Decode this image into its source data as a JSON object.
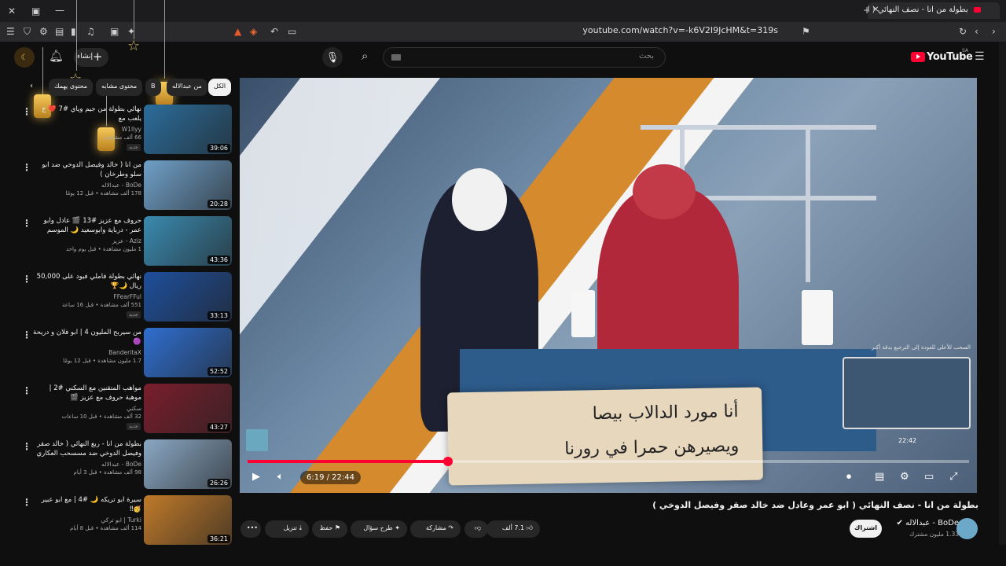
{
  "browser": {
    "tab_title": "بطولة من انا - نصف النهائي ( ا...",
    "url": "youtube.com/watch?v=-k6V2I9JcHM&t=319s",
    "new_tab": "+",
    "close_tab": "✕"
  },
  "masthead": {
    "logo": "YouTube",
    "logo_region": "SA",
    "search_placeholder": "بحث",
    "create_label": "إنشاء"
  },
  "chips": [
    {
      "label": "الكل",
      "active": true
    },
    {
      "label": "من عبدالاله",
      "active": false
    },
    {
      "label": "B",
      "active": false
    },
    {
      "label": "محتوى مشابه",
      "active": false
    },
    {
      "label": "محتوى يهمك",
      "active": false
    }
  ],
  "videos": [
    {
      "title": "نهائي بطولة من جيم وياي #7 ❤️ ع يلعب مع",
      "channel": "W1llyy",
      "meta": "66 ألف مشاهدة",
      "duration": "39:06",
      "new": "جديد",
      "color": "#2b6d9c"
    },
    {
      "title": "من انا ( خالد وفيصل الدوخي ضد ابو سلو وطرخان )",
      "channel": "BoDe - عبدالاله",
      "meta": "178 ألف مشاهدة • قبل 12 يومًا",
      "duration": "20:28",
      "new": "",
      "color": "#6fa0c8"
    },
    {
      "title": "حروف مع عزيز #13 🎬 عادل وابو عمر - درباية وابوسعيد 🌙 الموسم الثالث",
      "channel": "Aziz - عزيز",
      "meta": "1 مليون مشاهدة • قبل يوم واحد",
      "duration": "43:36",
      "new": "",
      "color": "#3a8ab0"
    },
    {
      "title": "نهائي بطولة فاملي فيود على 50,000 ريال 🌙🏆",
      "channel": "FFearFFul",
      "meta": "551 ألف مشاهدة • قبل 16 ساعة",
      "duration": "33:13",
      "new": "جديد",
      "color": "#1e4f9c"
    },
    {
      "title": "من سيربح المليون 4 | ابو فلان و دريحة 🟣",
      "channel": "BanderitaX",
      "meta": "1.7 مليون مشاهدة • قبل 12 يومًا",
      "duration": "52:52",
      "new": "",
      "color": "#2f6fd0"
    },
    {
      "title": "مواهب المتقنين مع السكني #2 | موهبة حروف مع عزيز 🎬",
      "channel": "سكني",
      "meta": "32 ألف مشاهدة • قبل 10 ساعات",
      "duration": "43:27",
      "new": "جديد",
      "color": "#7a1e2c"
    },
    {
      "title": "بطولة من انا - ربع النهائي ( خالد صقر وفيصل الدوخي ضد مسسحب العكاري وفيصل )",
      "channel": "BoDe - عبدالاله",
      "meta": "98 ألف مشاهدة • قبل 3 أيام",
      "duration": "26:26",
      "new": "",
      "color": "#8aa8c4"
    },
    {
      "title": "سيرة ابو تريكه 🌙 #4 | مع ابو عبير 🥳‼",
      "channel": "Turki | ابو تركي",
      "meta": "114 ألف مشاهدة • قبل 8 أيام",
      "duration": "36:21",
      "new": "",
      "color": "#c07a2a"
    }
  ],
  "player": {
    "current_time": "6:19",
    "total_time": "22:44",
    "time_display": "6:19 / 22:44",
    "progress": 0.278,
    "caption_line1": "أنا مورد الدالاب بيصا",
    "caption_line2": "ويصيرهن حمرا في رورنا",
    "mini_label": "السحب للأعلى للعودة إلى الترجيع بدقة أكبر",
    "mini_time": "22:42"
  },
  "watch": {
    "title": "بطولة من انا - نصف النهائي ( ابو عمر وعادل ضد خالد صقر وفيصل الدوخي )",
    "channel": "BoDe - عبدالاله",
    "subscribers": "1.33 مليون مشترك",
    "subscribe": "اشتراك",
    "likes": "7.1 ألف",
    "share": "مشاركة",
    "ask": "طرح سؤال",
    "save": "حفظ",
    "download": "تنزيل",
    "more": "•••"
  },
  "colors": {
    "accent": "#ff0033",
    "background": "#0f0f0f"
  }
}
